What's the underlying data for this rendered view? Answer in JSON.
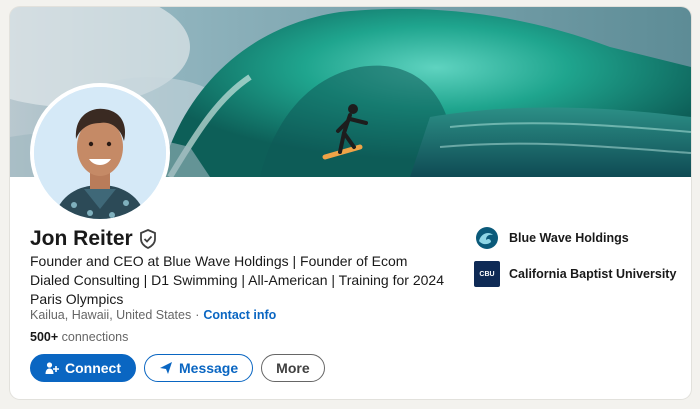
{
  "profile": {
    "name": "Jon Reiter",
    "headline": "Founder and CEO at Blue Wave Holdings | Founder of Ecom Dialed Consulting | D1 Swimming | All-American | Training for 2024 Paris Olympics",
    "location": "Kailua, Hawaii, United States",
    "separator": "·",
    "contact_info": "Contact info",
    "connections_count": "500+",
    "connections_label": "connections"
  },
  "actions": {
    "connect": "Connect",
    "message": "Message",
    "more": "More"
  },
  "organizations": [
    {
      "name": "Blue Wave Holdings",
      "icon": "wave-logo-icon"
    },
    {
      "name": "California Baptist University",
      "icon": "cbu-logo-icon",
      "logo_text": "CBU"
    }
  ],
  "colors": {
    "primary": "#0a66c2",
    "text": "#191919",
    "muted": "#666666"
  }
}
